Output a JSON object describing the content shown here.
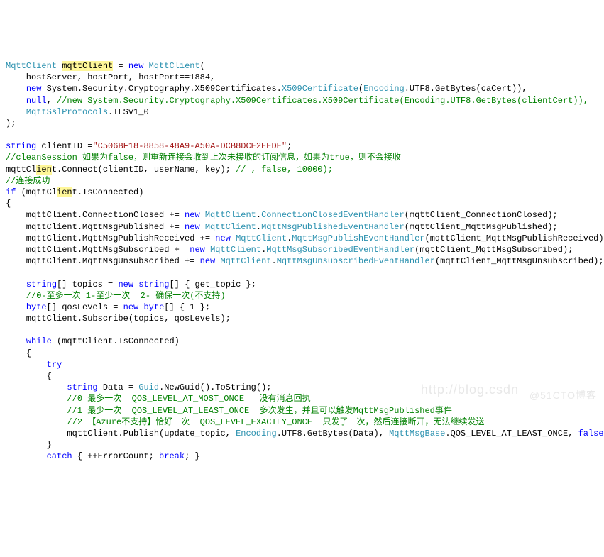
{
  "code": {
    "line1": {
      "a": "MqttClient",
      "b": " ",
      "c": "mqttClient",
      "d": " = ",
      "e": "new",
      "f": " ",
      "g": "MqttClient",
      "h": "("
    },
    "line2": "    hostServer, hostPort, hostPort==1884,",
    "line3": {
      "a": "    ",
      "b": "new",
      "c": " System.Security.Cryptography.X509Certificates.",
      "d": "X509Certificate",
      "e": "(",
      "f": "Encoding",
      "g": ".UTF8.GetBytes(caCert)),"
    },
    "line4": {
      "a": "    ",
      "b": "null",
      "c": ", ",
      "d": "//new System.Security.Cryptography.X509Certificates.X509Certificate(Encoding.UTF8.GetBytes(clientCert)),"
    },
    "line5": {
      "a": "    ",
      "b": "MqttSslProtocols",
      "c": ".TLSv1_0"
    },
    "line6": ");",
    "line8": {
      "a": "string",
      "b": " clientID =",
      "c": "\"C506BF18-8858-48A9-A50A-DCB8DCE2EEDE\"",
      "d": ";"
    },
    "line9": "//cleanSession 如果为false，则重新连接会收到上次未接收的订阅信息，如果为true，则不会接收",
    "line10": {
      "a": "mqttCl",
      "b": "ien",
      "c": "t",
      "d": ".Connect(clientID, userName, key);",
      "e": " // , false, 10000);"
    },
    "line11": "//连接成功",
    "line12": {
      "a": "if",
      "b": " (mqttCl",
      "c": "ien",
      "d": "t.IsConnected)"
    },
    "line13": "{",
    "line14": {
      "a": "    mqttClient.ConnectionClosed += ",
      "b": "new",
      "c": " ",
      "d": "MqttClient",
      "e": ".",
      "f": "ConnectionClosedEventHandler",
      "g": "(mqttClient_ConnectionClosed);"
    },
    "line15": {
      "a": "    mqttClient.MqttMsgPublished += ",
      "b": "new",
      "c": " ",
      "d": "MqttClient",
      "e": ".",
      "f": "MqttMsgPublishedEventHandler",
      "g": "(mqttClient_MqttMsgPublished);"
    },
    "line16": {
      "a": "    mqttClient.MqttMsgPublishReceived += ",
      "b": "new",
      "c": " ",
      "d": "MqttClient",
      "e": ".",
      "f": "MqttMsgPublishEventHandler",
      "g": "(mqttClient_MqttMsgPublishReceived);"
    },
    "line17": {
      "a": "    mqttClient.MqttMsgSubscribed += ",
      "b": "new",
      "c": " ",
      "d": "MqttClient",
      "e": ".",
      "f": "MqttMsgSubscribedEventHandler",
      "g": "(mqttClient_MqttMsgSubscribed);"
    },
    "line18": {
      "a": "    mqttClient.MqttMsgUnsubscribed += ",
      "b": "new",
      "c": " ",
      "d": "MqttClient",
      "e": ".",
      "f": "MqttMsgUnsubscribedEventHandler",
      "g": "(mqttClient_MqttMsgUnsubscribed);"
    },
    "line20": {
      "a": "    ",
      "b": "string",
      "c": "[] topics = ",
      "d": "new",
      "e": " ",
      "f": "string",
      "g": "[] { get_topic };"
    },
    "line21": "    //0-至多一次 1-至少一次  2- 确保一次(不支持)",
    "line22": {
      "a": "    ",
      "b": "byte",
      "c": "[] qosLevels = ",
      "d": "new",
      "e": " ",
      "f": "byte",
      "g": "[] { 1 };"
    },
    "line23": "    mqttClient.Subscribe(topics, qosLevels);",
    "line25": {
      "a": "    ",
      "b": "while",
      "c": " (mqttClient.IsConnected)"
    },
    "line26": "    {",
    "line27": {
      "a": "        ",
      "b": "try"
    },
    "line28": "        {",
    "line29": {
      "a": "            ",
      "b": "string",
      "c": " Data = ",
      "d": "Guid",
      "e": ".NewGuid().ToString();"
    },
    "line30": "            //0 最多一次  QOS_LEVEL_AT_MOST_ONCE   没有消息回执",
    "line31": "            //1 最少一次  QOS_LEVEL_AT_LEAST_ONCE  多次发生，并且可以触发MqttMsgPublished事件",
    "line32": "            //2 【Azure不支持】恰好一次  QOS_LEVEL_EXACTLY_ONCE  只发了一次，然后连接断开，无法继续发送",
    "line33": {
      "a": "            mqttClient.Publish(update_topic, ",
      "b": "Encoding",
      "c": ".UTF8.GetBytes(Data), ",
      "d": "MqttMsgBase",
      "e": ".QOS_LEVEL_AT_LEAST_ONCE, ",
      "f": "false",
      "g": ");"
    },
    "line34": "        }",
    "line35": {
      "a": "        ",
      "b": "catch",
      "c": " { ++ErrorCount; ",
      "d": "break",
      "e": "; }"
    }
  },
  "watermark1": "http://blog.csdn",
  "watermark2": "@51CTO博客"
}
